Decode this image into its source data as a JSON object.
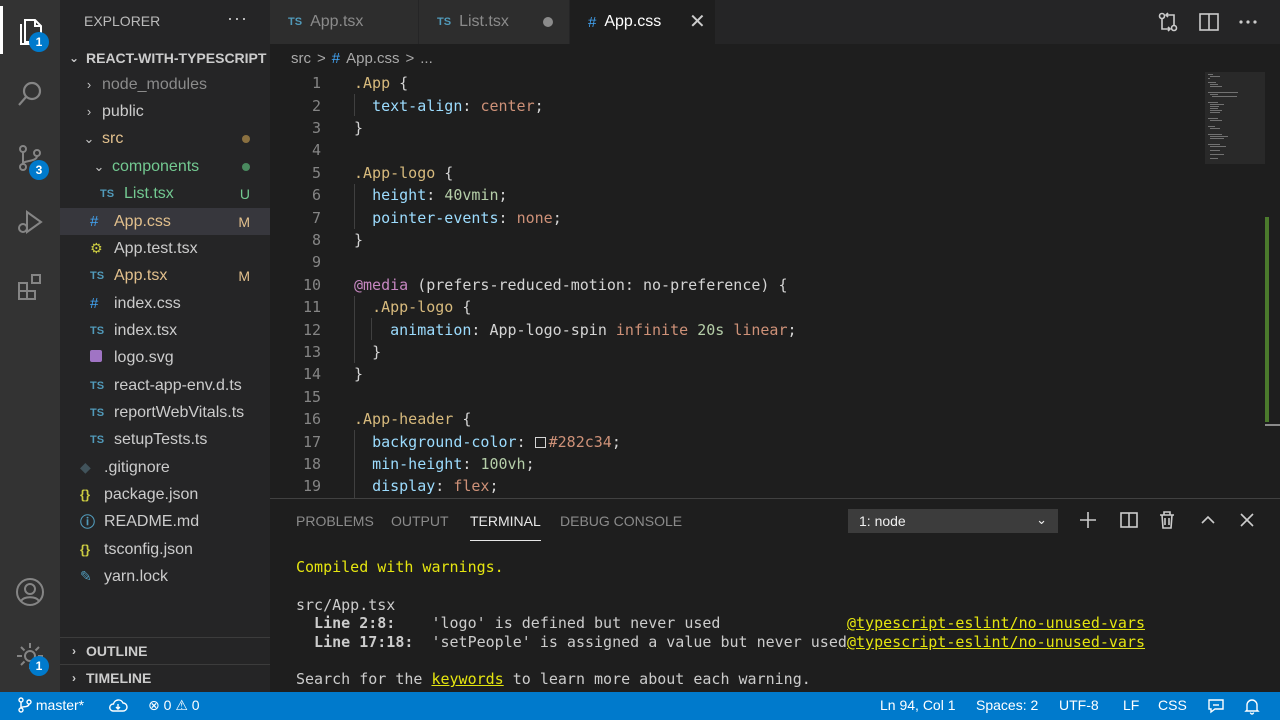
{
  "colors": {
    "accent": "#007acc",
    "modified": "#e2c08d",
    "untracked": "#73c991",
    "tsBlue": "#519aba",
    "cssBlue": "#42a5f5"
  },
  "activity_bar": {
    "explorer_badge": "1",
    "source_control_badge": "3",
    "settings_badge": "1"
  },
  "sidebar": {
    "title": "EXPLORER",
    "more": "···",
    "project": "REACT-WITH-TYPESCRIPT",
    "tree": [
      {
        "icon": "",
        "label": "node_modules",
        "chevron": "›",
        "status": ""
      },
      {
        "icon": "",
        "label": "public",
        "chevron": "›",
        "status": ""
      },
      {
        "icon": "",
        "label": "src",
        "chevron": "⌄",
        "status": ""
      },
      {
        "icon": "",
        "label": "components",
        "chevron": "⌄",
        "status": ""
      },
      {
        "icon": "TS",
        "label": "List.tsx",
        "chevron": "",
        "status": "U"
      },
      {
        "icon": "#",
        "label": "App.css",
        "chevron": "",
        "status": "M"
      },
      {
        "icon": "",
        "label": "App.test.tsx",
        "chevron": "",
        "status": ""
      },
      {
        "icon": "TS",
        "label": "App.tsx",
        "chevron": "",
        "status": "M"
      },
      {
        "icon": "#",
        "label": "index.css",
        "chevron": "",
        "status": ""
      },
      {
        "icon": "TS",
        "label": "index.tsx",
        "chevron": "",
        "status": ""
      },
      {
        "icon": "",
        "label": "logo.svg",
        "chevron": "",
        "status": ""
      },
      {
        "icon": "TS",
        "label": "react-app-env.d.ts",
        "chevron": "",
        "status": ""
      },
      {
        "icon": "TS",
        "label": "reportWebVitals.ts",
        "chevron": "",
        "status": ""
      },
      {
        "icon": "TS",
        "label": "setupTests.ts",
        "chevron": "",
        "status": ""
      },
      {
        "icon": "",
        "label": ".gitignore",
        "chevron": "",
        "status": ""
      },
      {
        "icon": "{}",
        "label": "package.json",
        "chevron": "",
        "status": ""
      },
      {
        "icon": "",
        "label": "README.md",
        "chevron": "",
        "status": ""
      },
      {
        "icon": "{}",
        "label": "tsconfig.json",
        "chevron": "",
        "status": ""
      },
      {
        "icon": "",
        "label": "yarn.lock",
        "chevron": "",
        "status": ""
      }
    ],
    "outline": "OUTLINE",
    "timeline": "TIMELINE"
  },
  "tabs": [
    {
      "icon": "TS",
      "label": "App.tsx"
    },
    {
      "icon": "TS",
      "label": "List.tsx"
    },
    {
      "icon": "#",
      "label": "App.css"
    }
  ],
  "tab_close": "✕",
  "breadcrumb": {
    "folder": "src",
    "sep": ">",
    "file_icon": "#",
    "file": "App.css",
    "more": "..."
  },
  "editor": {
    "line_numbers": [
      "1",
      "2",
      "3",
      "4",
      "5",
      "6",
      "7",
      "8",
      "9",
      "10",
      "11",
      "12",
      "13",
      "14",
      "15",
      "16",
      "17",
      "18",
      "19"
    ],
    "code": {
      "l1_sel": ".App",
      "l1_brace": " {",
      "l2_prop": "text-align",
      "l2_val": "center",
      "l3": "}",
      "l5_sel": ".App-logo",
      "l5_brace": " {",
      "l6_prop": "height",
      "l6_val": "40vmin",
      "l7_prop": "pointer-events",
      "l7_val": "none",
      "l8": "}",
      "l10_kw": "@media",
      "l10_rest": " (prefers-reduced-motion: no-preference) {",
      "l11_sel": ".App-logo",
      "l11_brace": " {",
      "l12_prop": "animation",
      "l12_name": " App-logo-spin ",
      "l12_v1": "infinite",
      "l12_v2": "20s",
      "l12_v3": "linear",
      "l13": "}",
      "l14": "}",
      "l16_sel": ".App-header",
      "l16_brace": " {",
      "l17_prop": "background-color",
      "l17_val": "#282c34",
      "l18_prop": "min-height",
      "l18_val": "100vh",
      "l19_prop": "display",
      "l19_val": "flex"
    }
  },
  "panel": {
    "tabs": [
      "PROBLEMS",
      "OUTPUT",
      "TERMINAL",
      "DEBUG CONSOLE"
    ],
    "terminal_select": "1: node",
    "terminal": {
      "compiled": "Compiled with warnings.",
      "file": "src/App.tsx",
      "w1_loc": "  Line 2:8:",
      "w1_msg": "    'logo' is defined but never used",
      "w1_rule": "@typescript-eslint/no-unused-vars",
      "w2_loc": "  Line 17:18:",
      "w2_msg": "  'setPeople' is assigned a value but never used",
      "w2_rule": "@typescript-eslint/no-unused-vars",
      "search_pre": "Search for the ",
      "search_kw": "keywords",
      "search_post": " to learn more about each warning."
    }
  },
  "statusbar": {
    "branch": "master*",
    "errors": "0",
    "warnings": "0",
    "position": "Ln 94, Col 1",
    "spaces": "Spaces: 2",
    "encoding": "UTF-8",
    "eol": "LF",
    "language": "CSS"
  }
}
